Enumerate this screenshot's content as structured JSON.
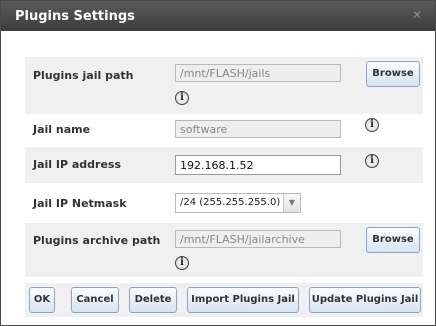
{
  "dialog": {
    "title": "Plugins Settings",
    "close_icon": "close-icon"
  },
  "form": {
    "plugins_jail_path": {
      "label": "Plugins jail path",
      "value": "/mnt/FLASH/jails",
      "browse_label": "Browse"
    },
    "jail_name": {
      "label": "Jail name",
      "value": "software"
    },
    "jail_ip_address": {
      "label": "Jail IP address",
      "value": "192.168.1.52"
    },
    "jail_ip_netmask": {
      "label": "Jail IP Netmask",
      "selected": "/24 (255.255.255.0)"
    },
    "plugins_archive_path": {
      "label": "Plugins archive path",
      "value": "/mnt/FLASH/jailarchive",
      "browse_label": "Browse"
    }
  },
  "buttons": {
    "ok": "OK",
    "cancel": "Cancel",
    "delete": "Delete",
    "import": "Import Plugins Jail",
    "update": "Update Plugins Jail"
  },
  "info_icon_glyph": "i"
}
